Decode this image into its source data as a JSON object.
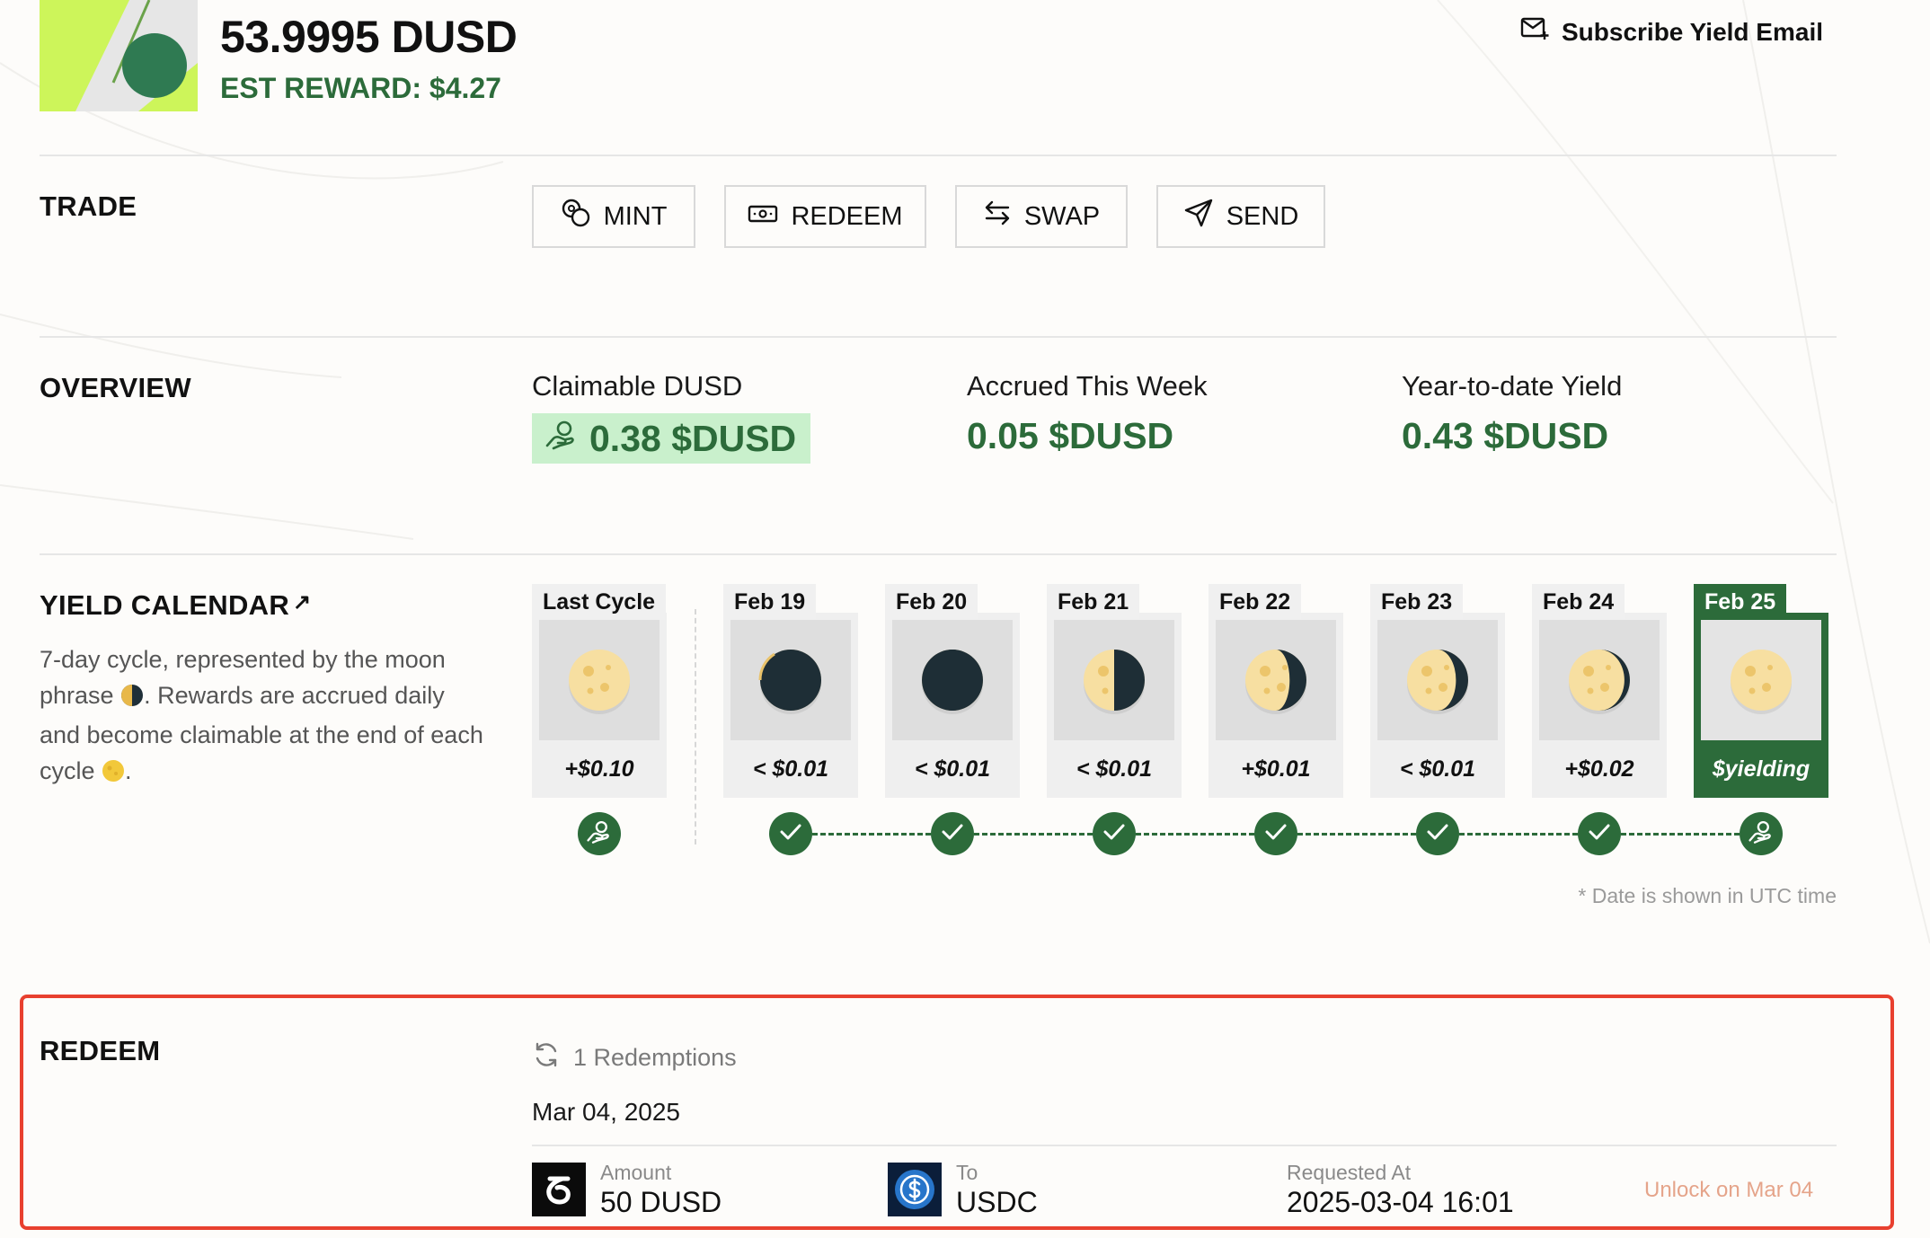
{
  "header": {
    "balance": "53.9995 DUSD",
    "est_reward": "EST REWARD: $4.27",
    "subscribe_label": "Subscribe Yield Email"
  },
  "trade": {
    "title": "TRADE",
    "buttons": [
      {
        "label": "MINT",
        "icon": "mint-coins-icon"
      },
      {
        "label": "REDEEM",
        "icon": "cash-icon"
      },
      {
        "label": "SWAP",
        "icon": "swap-arrows-icon"
      },
      {
        "label": "SEND",
        "icon": "send-paper-plane-icon"
      }
    ]
  },
  "overview": {
    "title": "OVERVIEW",
    "claimable_label": "Claimable DUSD",
    "claimable_value": "0.38 $DUSD",
    "accrued_label": "Accrued This Week",
    "accrued_value": "0.05 $DUSD",
    "ytd_label": "Year-to-date Yield",
    "ytd_value": "0.43 $DUSD"
  },
  "yield_calendar": {
    "title": "YIELD CALENDAR",
    "title_arrow": "↗",
    "desc_1": "7-day cycle, represented by the moon phrase",
    "desc_2": ". Rewards are accrued daily and become claimable at the end of each cycle",
    "desc_3": ".",
    "days": [
      {
        "date": "Last Cycle",
        "amount": "+$0.10",
        "phase": "full",
        "status": "claim"
      },
      {
        "date": "Feb 19",
        "amount": "< $0.01",
        "phase": "new",
        "status": "done"
      },
      {
        "date": "Feb 20",
        "amount": "< $0.01",
        "phase": "waxing-crescent",
        "status": "done"
      },
      {
        "date": "Feb 21",
        "amount": "< $0.01",
        "phase": "first-quarter",
        "status": "done"
      },
      {
        "date": "Feb 22",
        "amount": "+$0.01",
        "phase": "waxing-gibbous",
        "status": "done"
      },
      {
        "date": "Feb 23",
        "amount": "< $0.01",
        "phase": "gibbous-2",
        "status": "done"
      },
      {
        "date": "Feb 24",
        "amount": "+$0.02",
        "phase": "near-full",
        "status": "done"
      },
      {
        "date": "Feb 25",
        "amount": "$yielding",
        "phase": "full",
        "status": "claim",
        "current": true
      }
    ],
    "utc_note": "* Date is shown in UTC time"
  },
  "redeem": {
    "title": "REDEEM",
    "count_label": "1 Redemptions",
    "date": "Mar 04, 2025",
    "amount_label": "Amount",
    "amount_value": "50 DUSD",
    "to_label": "To",
    "to_value": "USDC",
    "requested_label": "Requested At",
    "requested_value": "2025-03-04 16:01",
    "unlock_label": "Unlock on Mar 04"
  },
  "colors": {
    "brand_green": "#2c6b3a",
    "claim_pill_bg": "#c9f0cc",
    "highlight_border": "#e8402f",
    "unlock_text": "#e5a48a",
    "token_bg_lime": "#cdf55a"
  }
}
